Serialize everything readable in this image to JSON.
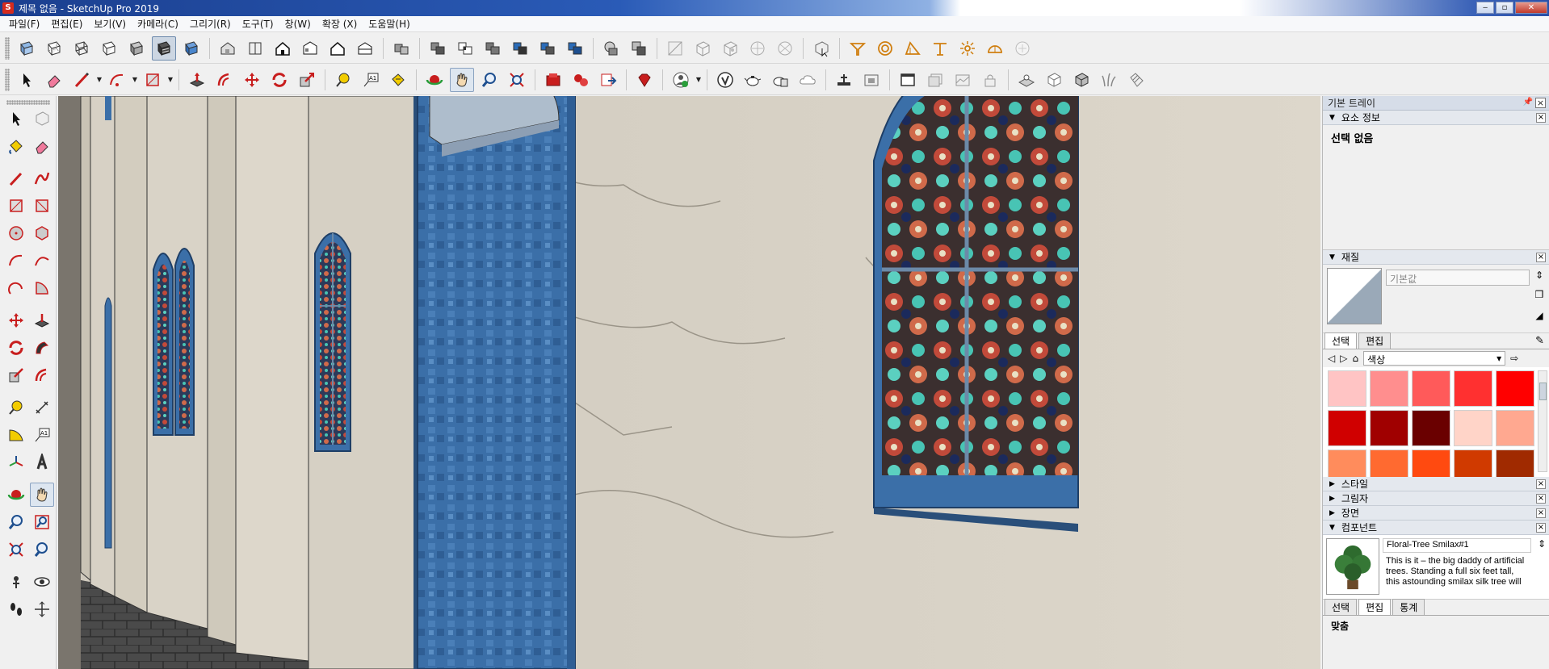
{
  "window": {
    "title": "제목 없음 - SketchUp Pro 2019",
    "app_icon": "sketchup-logo-icon",
    "buttons": {
      "minimize": "‒",
      "maximize": "▫",
      "close": "✕"
    }
  },
  "menu": [
    "파일(F)",
    "편집(E)",
    "보기(V)",
    "카메라(C)",
    "그리기(R)",
    "도구(T)",
    "창(W)",
    "확장 (X)",
    "도움말(H)"
  ],
  "toolbar_row1": {
    "groups": [
      [
        "xray-icon",
        "back-edges-icon",
        "wireframe-icon",
        "hidden-line-icon",
        "shaded-icon",
        "shaded-textures-icon",
        "monochrome-icon"
      ],
      [
        "iso-view-icon",
        "top-view-icon",
        "front-view-icon",
        "right-view-icon",
        "back-view-icon",
        "left-view-icon"
      ],
      [
        "components-icon"
      ],
      [
        "outer-shell-icon",
        "intersect-icon",
        "union-icon",
        "subtract-icon",
        "trim-icon",
        "split-icon"
      ],
      [
        "section-plane-icon",
        "section-fill-icon"
      ],
      [
        "solid-tools-icon",
        "sandbox-from-contours-icon",
        "sandbox-from-scratch-icon",
        "smoove-icon",
        "stamp-icon"
      ],
      [
        "component-select-icon"
      ],
      [
        "position-camera-icon",
        "look-around-icon",
        "walk-icon",
        "section-display-icon",
        "section-cuts-icon",
        "hide-rest-icon"
      ]
    ]
  },
  "toolbar_row2": {
    "groups": [
      [
        "select-icon",
        "eraser-icon",
        "line-icon",
        "arc-icon",
        "rectangle-icon"
      ],
      [
        "push-pull-icon",
        "offset-icon",
        "move-icon",
        "rotate-icon",
        "scale-icon"
      ],
      [
        "tape-measure-icon",
        "text-icon",
        "paint-bucket-icon"
      ],
      [
        "orbit-icon",
        "pan-icon",
        "zoom-icon",
        "zoom-extents-icon"
      ],
      [
        "3d-warehouse-icon",
        "extension-warehouse-icon",
        "layout-send-icon"
      ],
      [
        "extension-manager-icon"
      ],
      [
        "account-icon"
      ],
      [
        "model-info-icon",
        "teapot-icon",
        "generate-report-icon",
        "cloud-icon"
      ],
      [
        "add-location-icon",
        "photo-texture-icon"
      ],
      [
        "scenes-icon",
        "shadows-icon",
        "fog-icon",
        "lock-icon"
      ],
      [
        "sandbox-icon",
        "box-icon",
        "dynamic-component-icon",
        "grass-icon",
        "tag-icon"
      ]
    ]
  },
  "left_toolbar": [
    [
      "select-icon",
      "make-component-icon"
    ],
    [
      "paint-bucket-icon",
      "eraser-icon"
    ],
    [
      "line-icon",
      "freehand-icon"
    ],
    [
      "rectangle-icon",
      "rotated-rectangle-icon"
    ],
    [
      "circle-icon",
      "polygon-icon"
    ],
    [
      "arc-icon",
      "two-point-arc-icon"
    ],
    [
      "three-point-arc-icon",
      "pie-icon"
    ],
    [
      "move-icon",
      "push-pull-icon"
    ],
    [
      "rotate-icon",
      "follow-me-icon"
    ],
    [
      "scale-icon",
      "offset-icon"
    ],
    [
      "tape-measure-icon",
      "dimension-icon"
    ],
    [
      "protractor-icon",
      "text-icon"
    ],
    [
      "axes-icon",
      "3d-text-icon"
    ],
    [
      "orbit-icon",
      "pan-icon"
    ],
    [
      "zoom-icon",
      "zoom-window-icon"
    ],
    [
      "zoom-extents-icon",
      "previous-view-icon"
    ],
    [
      "position-camera-icon",
      "look-around-icon"
    ],
    [
      "walk-icon",
      "section-plane-icon"
    ]
  ],
  "tray": {
    "title": "기본 트레이",
    "entity_info": {
      "header": "요소 정보",
      "status": "선택 없음"
    },
    "materials": {
      "header": "재질",
      "name": "기본값",
      "tabs": [
        "선택",
        "편집"
      ],
      "collection": "색상",
      "swatch_colors": [
        "#ffc4c4",
        "#ff8e8e",
        "#ff5a5a",
        "#ff3030",
        "#ff0000",
        "#d00000",
        "#a00000",
        "#6a0000",
        "#ffd4c8",
        "#ffa890",
        "#ff8c5c",
        "#ff6a30",
        "#ff4a10",
        "#d03a00",
        "#a02a00"
      ]
    },
    "collapsed_panels": [
      "스타일",
      "그림자",
      "장면"
    ],
    "components": {
      "header": "컴포넌트",
      "name": "Floral-Tree Smilax#1",
      "description": "This is it – the big daddy of artificial trees. Standing a full six feet tall, this astounding smilax silk tree will",
      "tabs": [
        "선택",
        "편집",
        "통계"
      ],
      "section_label": "맞춤"
    }
  },
  "colors": {
    "wall": "#d9d3c7",
    "frame_blue": "#3b6fa8",
    "floor": "#4a4a4a"
  }
}
